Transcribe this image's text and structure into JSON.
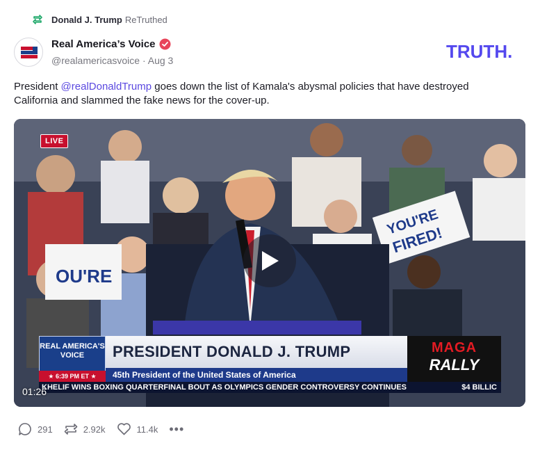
{
  "retruth": {
    "icon": "retruth-icon",
    "user": "Donald J. Trump",
    "label": "ReTruthed"
  },
  "author": {
    "name": "Real America’s Voice",
    "verified_icon": "verified-badge-icon",
    "handle": "@realamericasvoice",
    "separator": "·",
    "date": "Aug 3"
  },
  "brand": {
    "logo": "TRUTH.",
    "color": "#5448ee"
  },
  "post": {
    "text_before": "President ",
    "mention": "@realDonaldTrump",
    "text_after": " goes down the list of Kamala's abysmal policies that have destroyed California and slammed the fake news for the cover-up."
  },
  "video": {
    "live_badge": "LIVE",
    "timecode": "01:26",
    "lower_third": {
      "logo": "REAL AMERICA'S VOICE",
      "time": "★ 6:39 PM ET ★",
      "headline": "PRESIDENT DONALD J. TRUMP",
      "subheadline": "45th President of the United States of America",
      "rally_top": "MAGA",
      "rally_bottom": "RALLY",
      "ticker": "KHELIF WINS BOXING QUARTERFINAL BOUT AS OLYMPICS GENDER CONTROVERSY CONTINUES",
      "ticker_right": "$4 BILLIC"
    }
  },
  "actions": {
    "replies": "291",
    "retruths": "2.92k",
    "likes": "11.4k",
    "more": "•••"
  },
  "colors": {
    "accent": "#5448ee",
    "mention": "#5a48e0",
    "retruth_green": "#1fa86a",
    "verified_red": "#e8445a"
  }
}
